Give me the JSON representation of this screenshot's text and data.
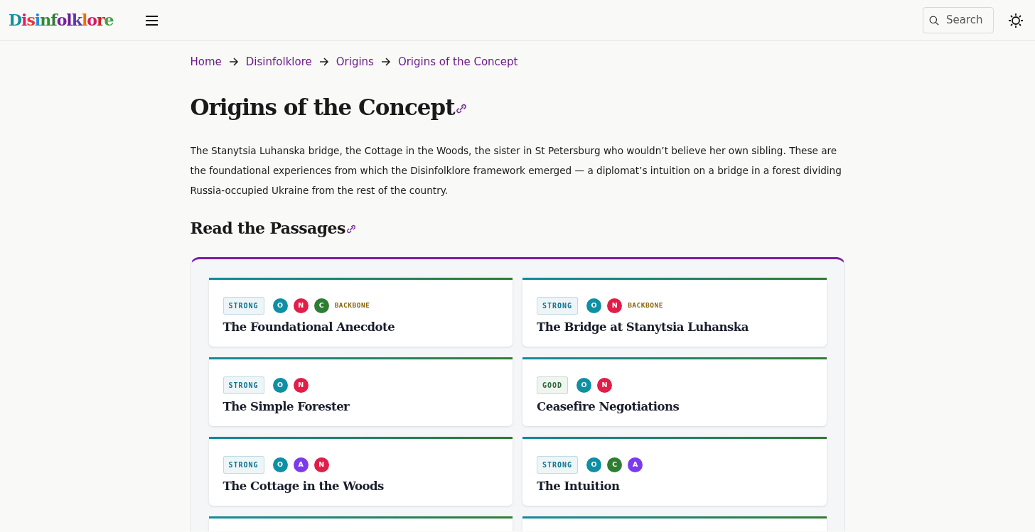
{
  "logo": "Disinfolklore",
  "search": {
    "placeholder": "Search"
  },
  "breadcrumb": [
    {
      "label": "Home"
    },
    {
      "label": "Disinfolklore"
    },
    {
      "label": "Origins"
    },
    {
      "label": "Origins of the Concept"
    }
  ],
  "title": "Origins of the Concept",
  "intro": "The Stanytsia Luhanska bridge, the Cottage in the Woods, the sister in St Petersburg who wouldn’t believe her own sibling. These are the foundational experiences from which the Disinfolklore framework emerged — a diplomat’s intuition on a bridge in a forest dividing Russia-occupied Ukraine from the rest of the country.",
  "section_title": "Read the Passages",
  "cards": [
    {
      "kind": "full",
      "rating": {
        "label": "STRONG",
        "color": "#0e7490"
      },
      "dots": [
        {
          "letter": "O",
          "color": "#0e8fa3"
        },
        {
          "letter": "N",
          "color": "#e11d48"
        },
        {
          "letter": "C",
          "color": "#2e7d32"
        }
      ],
      "tag": "BACKBONE",
      "title": "The Foundational Anecdote"
    },
    {
      "kind": "full",
      "rating": {
        "label": "STRONG",
        "color": "#0e7490"
      },
      "dots": [
        {
          "letter": "O",
          "color": "#0e8fa3"
        },
        {
          "letter": "N",
          "color": "#e11d48"
        }
      ],
      "tag": "BACKBONE",
      "title": "The Bridge at Stanytsia Luhanska"
    },
    {
      "kind": "full",
      "rating": {
        "label": "STRONG",
        "color": "#0e7490"
      },
      "dots": [
        {
          "letter": "O",
          "color": "#0e8fa3"
        },
        {
          "letter": "N",
          "color": "#e11d48"
        }
      ],
      "title": "The Simple Forester"
    },
    {
      "kind": "full",
      "rating": {
        "label": "GOOD",
        "color": "#2e6b3a"
      },
      "dots": [
        {
          "letter": "O",
          "color": "#0e8fa3"
        },
        {
          "letter": "N",
          "color": "#e11d48"
        }
      ],
      "title": "Ceasefire Negotiations"
    },
    {
      "kind": "full",
      "rating": {
        "label": "STRONG",
        "color": "#0e7490"
      },
      "dots": [
        {
          "letter": "O",
          "color": "#0e8fa3"
        },
        {
          "letter": "A",
          "color": "#7c3aed"
        },
        {
          "letter": "N",
          "color": "#e11d48"
        }
      ],
      "title": "The Cottage in the Woods"
    },
    {
      "kind": "full",
      "rating": {
        "label": "STRONG",
        "color": "#0e7490"
      },
      "dots": [
        {
          "letter": "O",
          "color": "#0e8fa3"
        },
        {
          "letter": "C",
          "color": "#2e7d32"
        },
        {
          "letter": "A",
          "color": "#7c3aed"
        }
      ],
      "title": "The Intuition"
    },
    {
      "kind": "partial"
    },
    {
      "kind": "partial"
    }
  ]
}
